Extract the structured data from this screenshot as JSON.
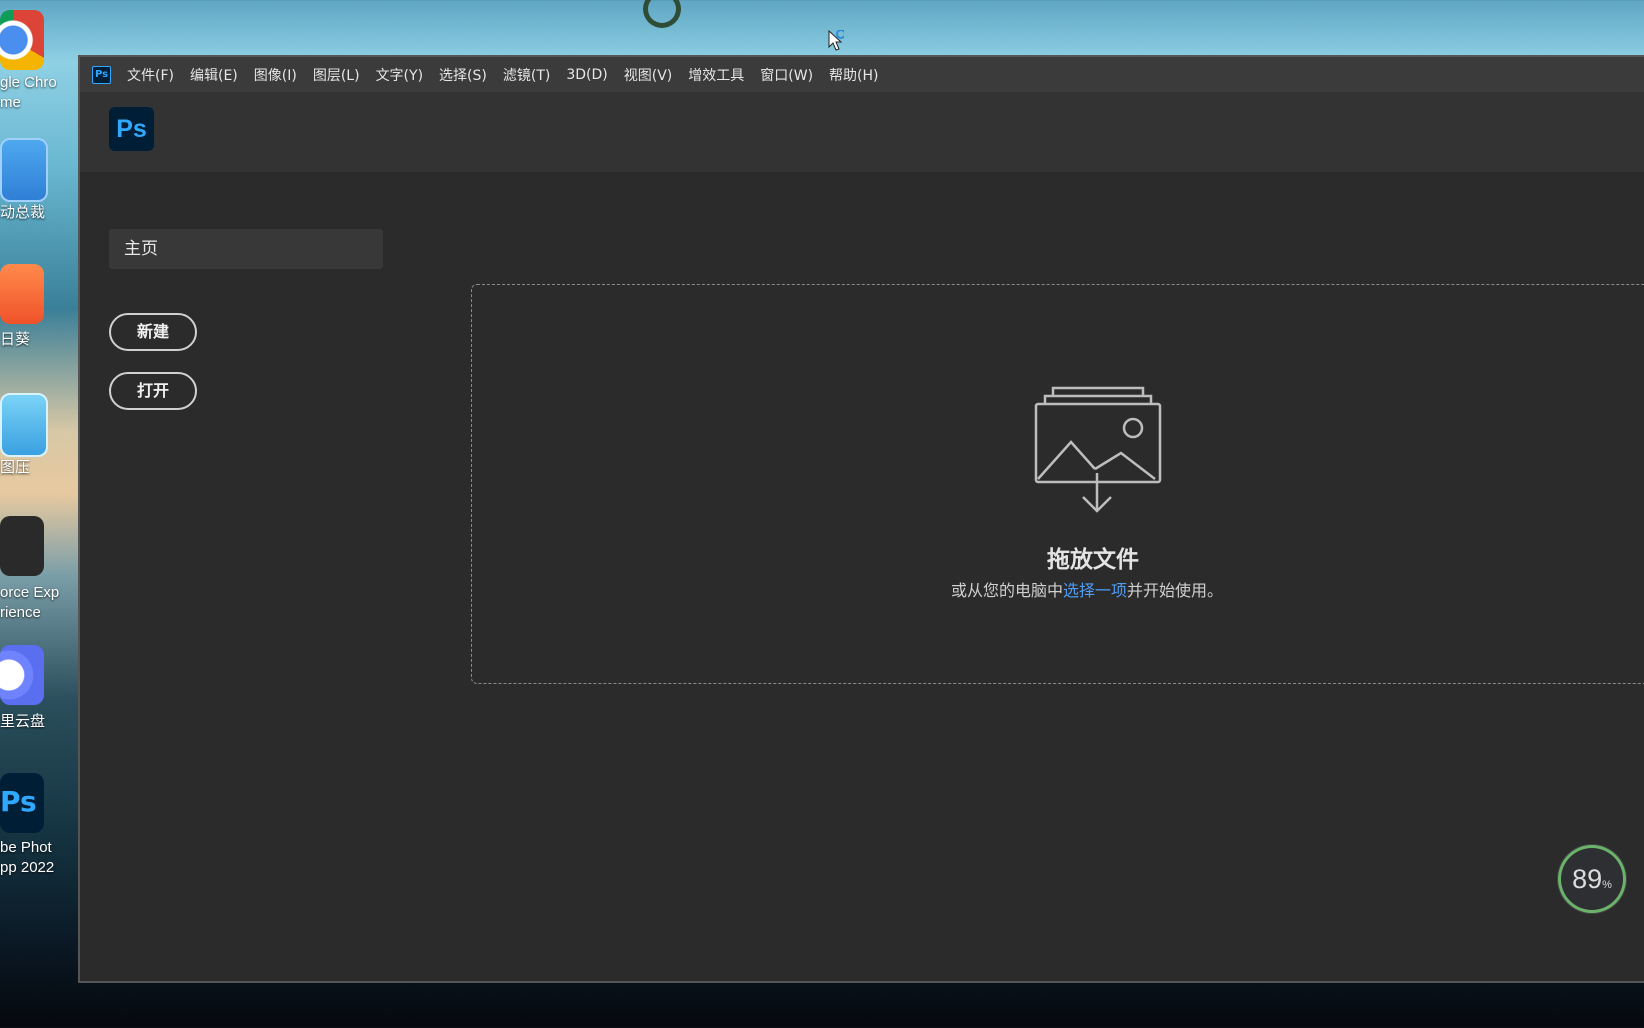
{
  "desktop": {
    "icons": [
      {
        "label": "gle Chro\nme",
        "icon": "chrome-icon"
      },
      {
        "label": "动总裁",
        "icon": "gear-app-icon"
      },
      {
        "label": "日葵",
        "icon": "sunflower-icon"
      },
      {
        "label": "图压",
        "icon": "image-compress-icon"
      },
      {
        "label": "orce Exp\nrience",
        "icon": "nvidia-icon"
      },
      {
        "label": "里云盘",
        "icon": "cloud-drive-icon"
      },
      {
        "label": "be Phot\npp 2022",
        "icon": "photoshop-icon"
      }
    ],
    "ps_icon_text": "Ps"
  },
  "window": {
    "app_icon_text": "Ps",
    "menu": [
      "文件(F)",
      "编辑(E)",
      "图像(I)",
      "图层(L)",
      "文字(Y)",
      "选择(S)",
      "滤镜(T)",
      "3D(D)",
      "视图(V)",
      "增效工具",
      "窗口(W)",
      "帮助(H)"
    ],
    "logo_text": "Ps",
    "home_tab": "主页",
    "new_button": "新建",
    "open_button": "打开",
    "dropzone": {
      "title": "拖放文件",
      "sub_before": "或从您的电脑中",
      "sub_link": "选择一项",
      "sub_after": "并开始使用。",
      "icon": "image-drop-icon"
    }
  },
  "perf_widget": {
    "value": "89",
    "unit": "%"
  },
  "colors": {
    "accent_link": "#4d9cf5",
    "ps_blue": "#31a8ff",
    "ps_dark": "#001e36",
    "panel_bg": "#2b2b2b"
  }
}
